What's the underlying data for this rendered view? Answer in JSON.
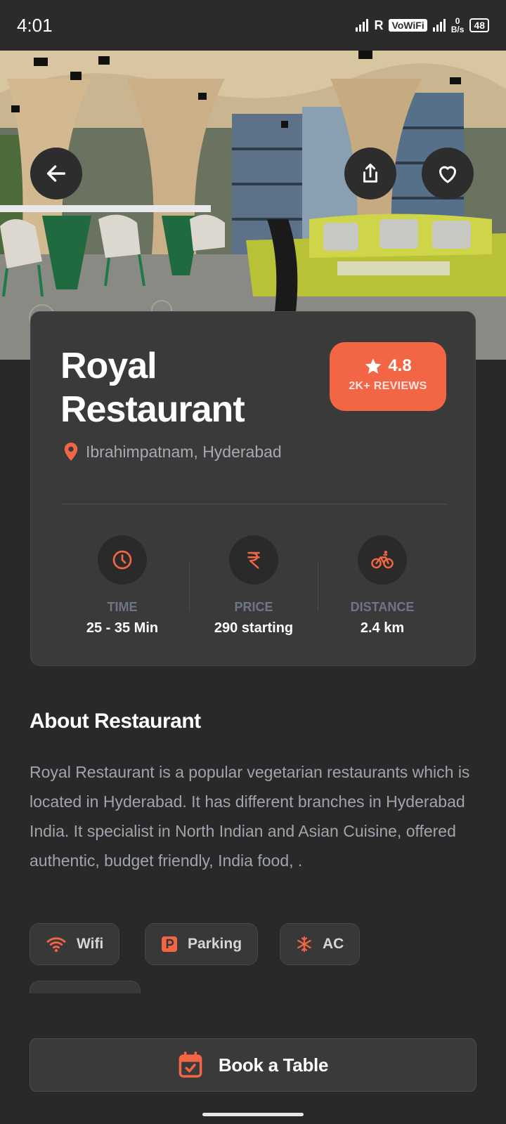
{
  "status_bar": {
    "time": "4:01",
    "network_r": "R",
    "vowifi": "VoWiFi",
    "speed_value": "0",
    "speed_unit": "B/s",
    "battery": "48"
  },
  "restaurant": {
    "name": "Royal Restaurant",
    "rating": "4.8",
    "reviews": "2K+ REVIEWS",
    "location": "Ibrahimpatnam, Hyderabad"
  },
  "stats": [
    {
      "label": "TIME",
      "value": "25 - 35 Min",
      "icon": "clock-icon"
    },
    {
      "label": "PRICE",
      "value": "290 starting",
      "icon": "rupee-icon"
    },
    {
      "label": "DISTANCE",
      "value": "2.4 km",
      "icon": "bicycle-icon"
    }
  ],
  "about": {
    "title": "About Restaurant",
    "text": "Royal Restaurant is a popular vegetarian restaurants which is located in Hyderabad. It has different branches in Hyderabad India. It specialist in North Indian and Asian Cuisine, offered authentic, budget friendly, India food, ."
  },
  "amenities": [
    {
      "label": "Wifi",
      "icon": "wifi-icon"
    },
    {
      "label": "Parking",
      "icon": "parking-icon"
    },
    {
      "label": "AC",
      "icon": "snowflake-icon"
    }
  ],
  "cta": {
    "label": "Book a Table",
    "icon": "calendar-check-icon"
  },
  "colors": {
    "accent": "#f26645",
    "background": "#292929",
    "card": "#3a3a3a"
  }
}
